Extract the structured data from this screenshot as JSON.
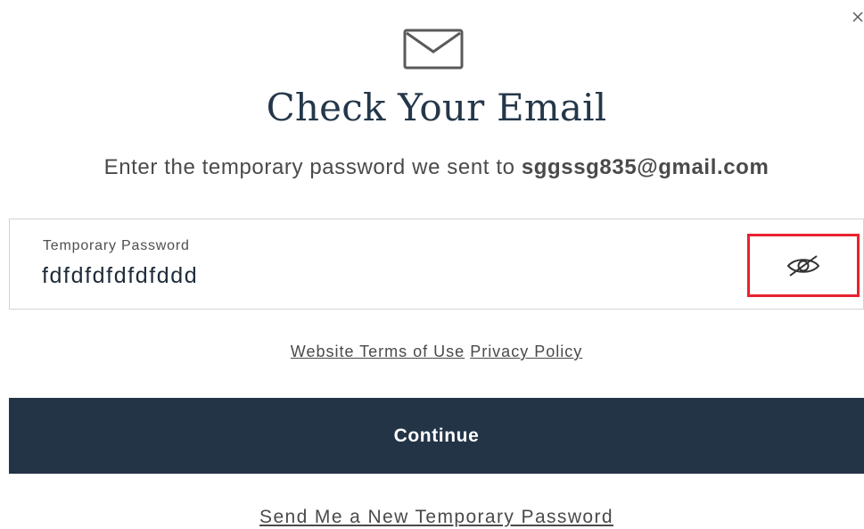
{
  "header": {
    "close_icon": "close-icon",
    "envelope_icon": "envelope-icon",
    "title": "Check Your Email"
  },
  "message": {
    "prefix": "Enter the temporary password we sent to ",
    "email": "sggssg835@gmail.com"
  },
  "password_field": {
    "label": "Temporary Password",
    "value": "fdfdfdfdfdfddd",
    "toggle_icon": "eye-slash-icon",
    "highlight_color": "#e8232f"
  },
  "links": {
    "terms": "Website Terms of Use",
    "privacy": "Privacy Policy"
  },
  "actions": {
    "continue_label": "Continue",
    "continue_color": "#243447",
    "resend_label": "Send Me a New Temporary Password"
  }
}
